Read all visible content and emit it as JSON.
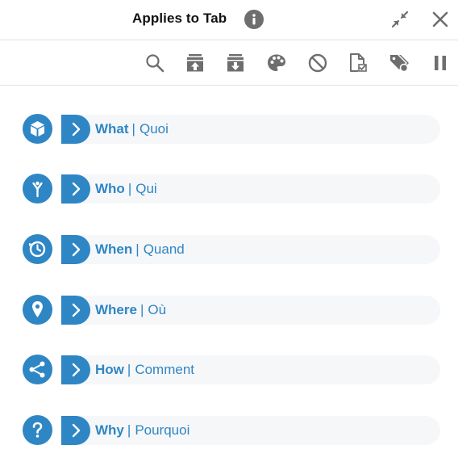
{
  "header": {
    "title": "Applies to Tab"
  },
  "toolbar": {
    "tools": [
      "search-icon",
      "archive-up-icon",
      "archive-down-icon",
      "palette-icon",
      "block-icon",
      "document-check-icon",
      "tags-icon",
      "pause-icon"
    ]
  },
  "rows": [
    {
      "key": "what",
      "primary": "What",
      "sep": "|",
      "secondary": "Quoi",
      "icon": "cube-icon"
    },
    {
      "key": "who",
      "primary": "Who",
      "sep": "|",
      "secondary": "Qui",
      "icon": "person-icon"
    },
    {
      "key": "when",
      "primary": "When",
      "sep": "|",
      "secondary": "Quand",
      "icon": "clock-icon"
    },
    {
      "key": "where",
      "primary": "Where",
      "sep": "|",
      "secondary": "Où",
      "icon": "map-pin-icon"
    },
    {
      "key": "how",
      "primary": "How",
      "sep": "|",
      "secondary": "Comment",
      "icon": "share-icon"
    },
    {
      "key": "why",
      "primary": "Why",
      "sep": "|",
      "secondary": "Pourquoi",
      "icon": "question-icon"
    }
  ],
  "colors": {
    "accent": "#2e86c4",
    "pill_bg": "#f6f7f9",
    "icon_gray": "#6e6e6e",
    "title": "#111111"
  }
}
